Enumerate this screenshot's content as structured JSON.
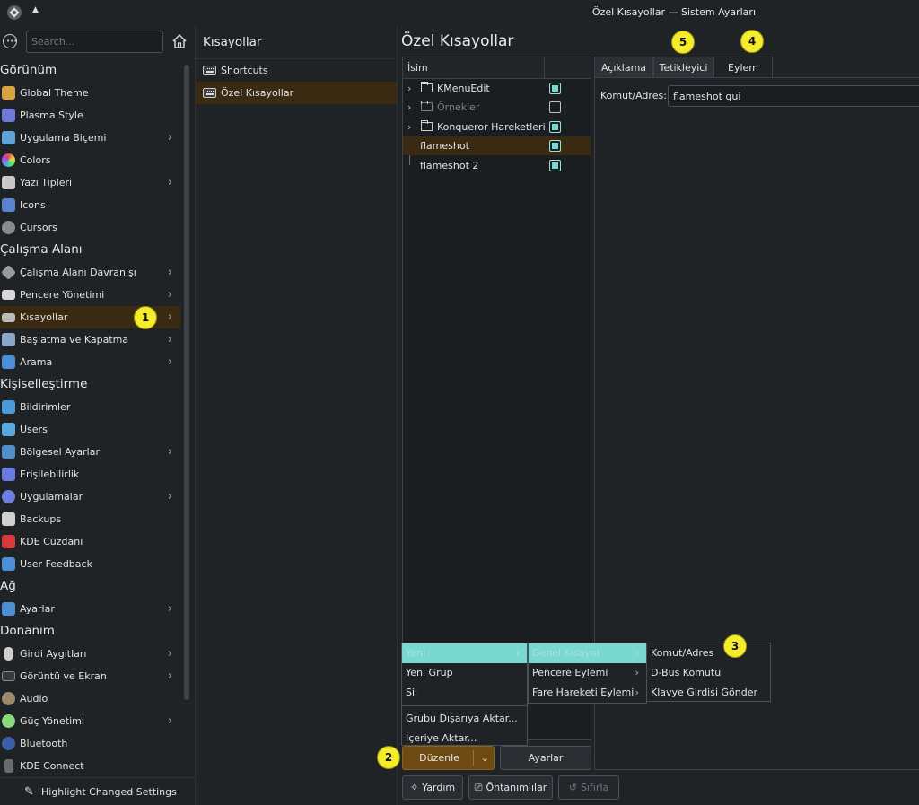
{
  "window": {
    "title": "Özel Kısayollar — Sistem Ayarları"
  },
  "sidebar": {
    "search_placeholder": "Search...",
    "groups": {
      "g0": "Görünüm",
      "g1": "Çalışma Alanı",
      "g2": "Kişiselleştirme",
      "g3": "Ağ",
      "g4": "Donanım"
    },
    "items": [
      {
        "label": "Global Theme",
        "icon": "global-theme-icon",
        "color": "#d9a441"
      },
      {
        "label": "Plasma Style",
        "icon": "plasma-style-icon",
        "color": "#6c7ad8"
      },
      {
        "label": "Uygulama Biçemi",
        "icon": "application-style-icon",
        "color": "#5fa4d9"
      },
      {
        "label": "Colors",
        "icon": "colors-icon",
        "color": "#e86aa8"
      },
      {
        "label": "Yazı Tipleri",
        "icon": "fonts-icon",
        "color": "#c8c8c8"
      },
      {
        "label": "Icons",
        "icon": "icons-icon",
        "color": "#5a84d0"
      },
      {
        "label": "Cursors",
        "icon": "cursors-icon",
        "color": "#8a8a8a"
      },
      {
        "label": "Çalışma Alanı Davranışı",
        "icon": "workspace-behavior-icon",
        "color": "#9a9a9a"
      },
      {
        "label": "Pencere Yönetimi",
        "icon": "window-management-icon",
        "color": "#d8d8d8"
      },
      {
        "label": "Kısayollar",
        "icon": "shortcuts-icon",
        "color": "#bdbdbd"
      },
      {
        "label": "Başlatma ve Kapatma",
        "icon": "startup-shutdown-icon",
        "color": "#8aa6c9"
      },
      {
        "label": "Arama",
        "icon": "search-settings-icon",
        "color": "#4a8fd8"
      },
      {
        "label": "Bildirimler",
        "icon": "notifications-icon",
        "color": "#4a9ad8"
      },
      {
        "label": "Users",
        "icon": "users-icon",
        "color": "#5aa8e0"
      },
      {
        "label": "Bölgesel Ayarlar",
        "icon": "regional-settings-icon",
        "color": "#4f8fd0"
      },
      {
        "label": "Erişilebilirlik",
        "icon": "accessibility-icon",
        "color": "#6a7be0"
      },
      {
        "label": "Uygulamalar",
        "icon": "applications-icon",
        "color": "#6a80e0"
      },
      {
        "label": "Backups",
        "icon": "backups-icon",
        "color": "#d0d0d0"
      },
      {
        "label": "KDE Cüzdanı",
        "icon": "kde-wallet-icon",
        "color": "#d83a3a"
      },
      {
        "label": "User Feedback",
        "icon": "user-feedback-icon",
        "color": "#4a8fd8"
      },
      {
        "label": "Ayarlar",
        "icon": "network-settings-icon",
        "color": "#4a8fd8"
      },
      {
        "label": "Girdi Aygıtları",
        "icon": "input-devices-icon",
        "color": "#cfcfcf"
      },
      {
        "label": "Görüntü ve Ekran",
        "icon": "display-icon",
        "color": "#3a3a3a"
      },
      {
        "label": "Audio",
        "icon": "audio-icon",
        "color": "#9a8a6a"
      },
      {
        "label": "Güç Yönetimi",
        "icon": "power-management-icon",
        "color": "#8ad87a"
      },
      {
        "label": "Bluetooth",
        "icon": "bluetooth-icon",
        "color": "#3d5fa8"
      },
      {
        "label": "KDE Connect",
        "icon": "kde-connect-icon",
        "color": "#6a6a6a"
      }
    ],
    "highlight_label": "Highlight Changed Settings"
  },
  "middle": {
    "title": "Kısayollar",
    "items": [
      "Shortcuts",
      "Özel Kısayollar"
    ]
  },
  "main": {
    "title": "Özel Kısayollar",
    "tree": {
      "column": "İsim",
      "rows": [
        {
          "label": "KMenuEdit",
          "checked": true
        },
        {
          "label": "Örnekler",
          "checked": false
        },
        {
          "label": "Konqueror Hareketleri",
          "checked": true
        },
        {
          "label": "flameshot",
          "checked": true
        },
        {
          "label": "flameshot 2",
          "checked": true
        }
      ]
    },
    "tabs": [
      "Açıklama",
      "Tetikleyici",
      "Eylem"
    ],
    "command_label": "Komut/Adres:",
    "command_value": "flameshot gui"
  },
  "buttons": {
    "edit": "Düzenle",
    "settings": "Ayarlar",
    "help": "Yardım",
    "defaults": "Öntanımlılar",
    "reset": "Sıfırla"
  },
  "menus": {
    "edit_menu": {
      "new": "Yeni",
      "new_group": "Yeni Grup",
      "delete": "Sil",
      "export_group": "Grubu Dışarıya Aktar...",
      "import": "İçeriye Aktar..."
    },
    "new_submenu": {
      "global_shortcut": "Genel Kısayol",
      "window_action": "Pencere Eylemi",
      "mouse_gesture_action": "Fare Hareketi Eylemi"
    },
    "action_submenu": [
      "Komut/Adres",
      "D-Bus Komutu",
      "Klavye Girdisi Gönder"
    ]
  },
  "badges": [
    "1",
    "2",
    "3",
    "4",
    "5"
  ],
  "colors": {
    "accent": "#79d8cf",
    "selection": "#3a2a12",
    "edit_button": "#6d4b13",
    "badge": "#f6ec2e"
  }
}
